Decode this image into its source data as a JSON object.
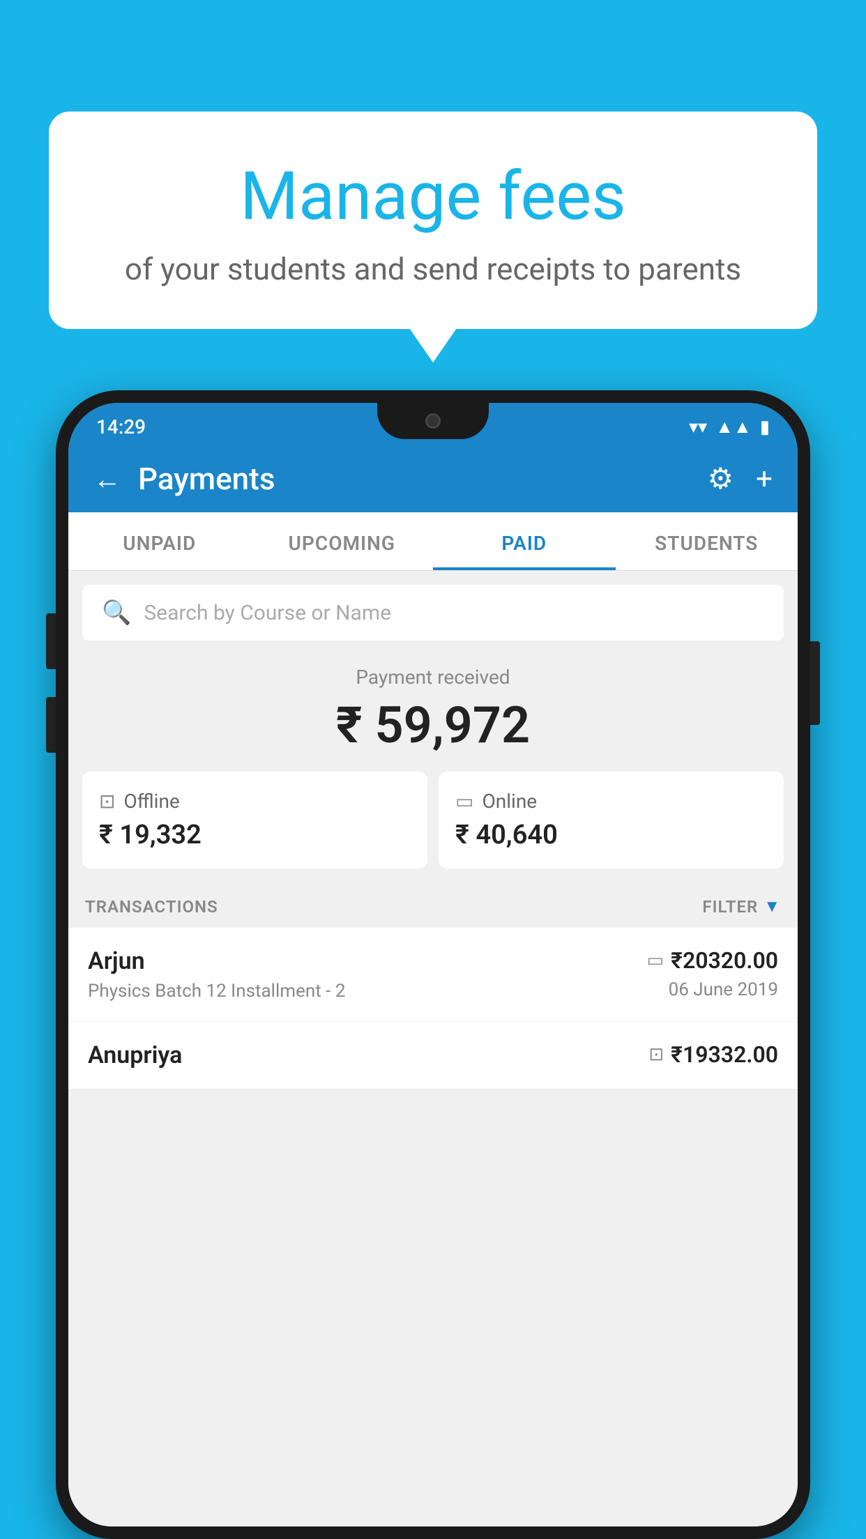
{
  "background_color": "#1ab5e8",
  "speech_bubble": {
    "title": "Manage fees",
    "subtitle": "of your students and send receipts to parents"
  },
  "phone": {
    "status_bar": {
      "time": "14:29",
      "wifi": "▼",
      "signal": "▲",
      "battery": "▌"
    },
    "header": {
      "back_label": "←",
      "title": "Payments",
      "settings_label": "⚙",
      "add_label": "+"
    },
    "tabs": [
      {
        "id": "unpaid",
        "label": "UNPAID",
        "active": false
      },
      {
        "id": "upcoming",
        "label": "UPCOMING",
        "active": false
      },
      {
        "id": "paid",
        "label": "PAID",
        "active": true
      },
      {
        "id": "students",
        "label": "STUDENTS",
        "active": false
      }
    ],
    "search": {
      "placeholder": "Search by Course or Name"
    },
    "payment_summary": {
      "label": "Payment received",
      "amount": "₹ 59,972",
      "offline": {
        "type": "Offline",
        "amount": "₹ 19,332"
      },
      "online": {
        "type": "Online",
        "amount": "₹ 40,640"
      }
    },
    "transactions": {
      "label": "TRANSACTIONS",
      "filter_label": "FILTER",
      "items": [
        {
          "name": "Arjun",
          "description": "Physics Batch 12 Installment - 2",
          "amount": "₹20320.00",
          "date": "06 June 2019",
          "payment_type": "online"
        },
        {
          "name": "Anupriya",
          "description": "",
          "amount": "₹19332.00",
          "date": "",
          "payment_type": "offline"
        }
      ]
    }
  }
}
